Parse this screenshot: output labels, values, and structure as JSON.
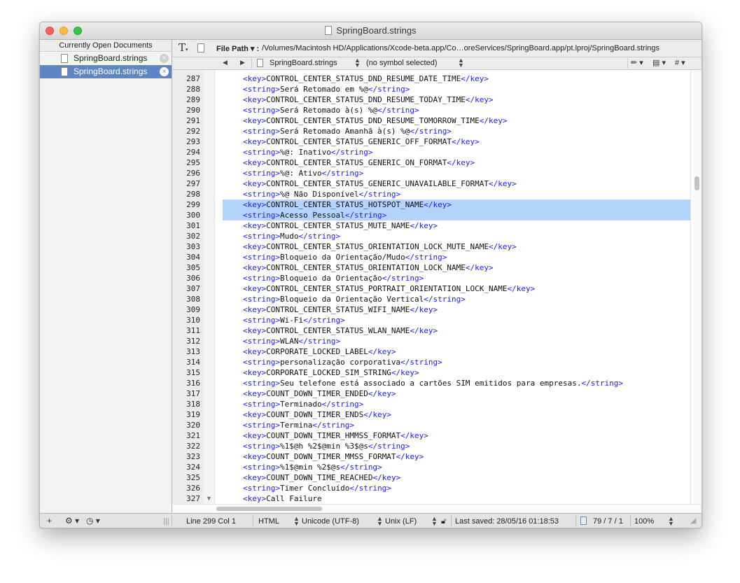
{
  "window": {
    "title": "SpringBoard.strings"
  },
  "sidebar": {
    "header": "Currently Open Documents",
    "items": [
      {
        "label": "SpringBoard.strings"
      },
      {
        "label": "SpringBoard.strings"
      }
    ]
  },
  "toolbar": {
    "file_path_label": "File Path ▾ :",
    "file_path": "/Volumes/Macintosh HD/Applications/Xcode-beta.app/Co…oreServices/SpringBoard.app/pt.lproj/SpringBoard.strings"
  },
  "navbar": {
    "back": "◀",
    "forward": "▶",
    "file": "SpringBoard.strings",
    "symbol": "(no symbol selected)",
    "tools": [
      "✏︎ ▾",
      "▤ ▾",
      "# ▾"
    ]
  },
  "editor": {
    "lines": [
      {
        "n": "287",
        "o": "<key>",
        "t": "CONTROL_CENTER_STATUS_DND_RESUME_DATE_TIME",
        "c": "</key>"
      },
      {
        "n": "288",
        "o": "<string>",
        "t": "Será Retomado em %@",
        "c": "</string>"
      },
      {
        "n": "289",
        "o": "<key>",
        "t": "CONTROL_CENTER_STATUS_DND_RESUME_TODAY_TIME",
        "c": "</key>"
      },
      {
        "n": "290",
        "o": "<string>",
        "t": "Será Retomado à(s) %@",
        "c": "</string>"
      },
      {
        "n": "291",
        "o": "<key>",
        "t": "CONTROL_CENTER_STATUS_DND_RESUME_TOMORROW_TIME",
        "c": "</key>"
      },
      {
        "n": "292",
        "o": "<string>",
        "t": "Será Retomado Amanhã à(s) %@",
        "c": "</string>"
      },
      {
        "n": "293",
        "o": "<key>",
        "t": "CONTROL_CENTER_STATUS_GENERIC_OFF_FORMAT",
        "c": "</key>"
      },
      {
        "n": "294",
        "o": "<string>",
        "t": "%@: Inativo",
        "c": "</string>"
      },
      {
        "n": "295",
        "o": "<key>",
        "t": "CONTROL_CENTER_STATUS_GENERIC_ON_FORMAT",
        "c": "</key>"
      },
      {
        "n": "296",
        "o": "<string>",
        "t": "%@: Ativo",
        "c": "</string>"
      },
      {
        "n": "297",
        "o": "<key>",
        "t": "CONTROL_CENTER_STATUS_GENERIC_UNAVAILABLE_FORMAT",
        "c": "</key>"
      },
      {
        "n": "298",
        "o": "<string>",
        "t": "%@ Não Disponível",
        "c": "</string>"
      },
      {
        "n": "299",
        "o": "<key>",
        "t": "CONTROL_CENTER_STATUS_HOTSPOT_NAME",
        "c": "</key>",
        "sel": true
      },
      {
        "n": "300",
        "o": "<string>",
        "t": "Acesso Pessoal",
        "c": "</string>",
        "sel": true
      },
      {
        "n": "301",
        "o": "<key>",
        "t": "CONTROL_CENTER_STATUS_MUTE_NAME",
        "c": "</key>"
      },
      {
        "n": "302",
        "o": "<string>",
        "t": "Mudo",
        "c": "</string>"
      },
      {
        "n": "303",
        "o": "<key>",
        "t": "CONTROL_CENTER_STATUS_ORIENTATION_LOCK_MUTE_NAME",
        "c": "</key>"
      },
      {
        "n": "304",
        "o": "<string>",
        "t": "Bloqueio da Orientação/Mudo",
        "c": "</string>"
      },
      {
        "n": "305",
        "o": "<key>",
        "t": "CONTROL_CENTER_STATUS_ORIENTATION_LOCK_NAME",
        "c": "</key>"
      },
      {
        "n": "306",
        "o": "<string>",
        "t": "Bloqueio da Orientação",
        "c": "</string>"
      },
      {
        "n": "307",
        "o": "<key>",
        "t": "CONTROL_CENTER_STATUS_PORTRAIT_ORIENTATION_LOCK_NAME",
        "c": "</key>"
      },
      {
        "n": "308",
        "o": "<string>",
        "t": "Bloqueio da Orientação Vertical",
        "c": "</string>"
      },
      {
        "n": "309",
        "o": "<key>",
        "t": "CONTROL_CENTER_STATUS_WIFI_NAME",
        "c": "</key>"
      },
      {
        "n": "310",
        "o": "<string>",
        "t": "Wi-Fi",
        "c": "</string>"
      },
      {
        "n": "311",
        "o": "<key>",
        "t": "CONTROL_CENTER_STATUS_WLAN_NAME",
        "c": "</key>"
      },
      {
        "n": "312",
        "o": "<string>",
        "t": "WLAN",
        "c": "</string>"
      },
      {
        "n": "313",
        "o": "<key>",
        "t": "CORPORATE_LOCKED_LABEL",
        "c": "</key>"
      },
      {
        "n": "314",
        "o": "<string>",
        "t": "personalização corporativa",
        "c": "</string>"
      },
      {
        "n": "315",
        "o": "<key>",
        "t": "CORPORATE_LOCKED_SIM_STRING",
        "c": "</key>"
      },
      {
        "n": "316",
        "o": "<string>",
        "t": "Seu telefone está associado a cartões SIM emitidos para empresas.",
        "c": "</string>"
      },
      {
        "n": "317",
        "o": "<key>",
        "t": "COUNT_DOWN_TIMER_ENDED",
        "c": "</key>"
      },
      {
        "n": "318",
        "o": "<string>",
        "t": "Terminado",
        "c": "</string>"
      },
      {
        "n": "319",
        "o": "<key>",
        "t": "COUNT_DOWN_TIMER_ENDS",
        "c": "</key>"
      },
      {
        "n": "320",
        "o": "<string>",
        "t": "Termina",
        "c": "</string>"
      },
      {
        "n": "321",
        "o": "<key>",
        "t": "COUNT_DOWN_TIMER_HMMSS_FORMAT",
        "c": "</key>"
      },
      {
        "n": "322",
        "o": "<string>",
        "t": "%1$@h %2$@min %3$@s",
        "c": "</string>"
      },
      {
        "n": "323",
        "o": "<key>",
        "t": "COUNT_DOWN_TIMER_MMSS_FORMAT",
        "c": "</key>"
      },
      {
        "n": "324",
        "o": "<string>",
        "t": "%1$@min %2$@s",
        "c": "</string>"
      },
      {
        "n": "325",
        "o": "<key>",
        "t": "COUNT_DOWN_TIME_REACHED",
        "c": "</key>"
      },
      {
        "n": "326",
        "o": "<string>",
        "t": "Timer Concluído",
        "c": "</string>"
      },
      {
        "n": "327",
        "o": "<key>",
        "t": "Call Failure",
        "c": "",
        "fold": true
      }
    ]
  },
  "status": {
    "add": "+",
    "gear": "⚙︎ ▾",
    "history": "◷ ▾",
    "grip": "|||",
    "position": "Line 299 Col 1",
    "syntax": "HTML",
    "encoding": "Unicode (UTF-8)",
    "line_endings": "Unix (LF)",
    "last_saved": "Last saved: 28/05/16 01:18:53",
    "counts": "79 / 7 / 1",
    "zoom": "100%"
  }
}
